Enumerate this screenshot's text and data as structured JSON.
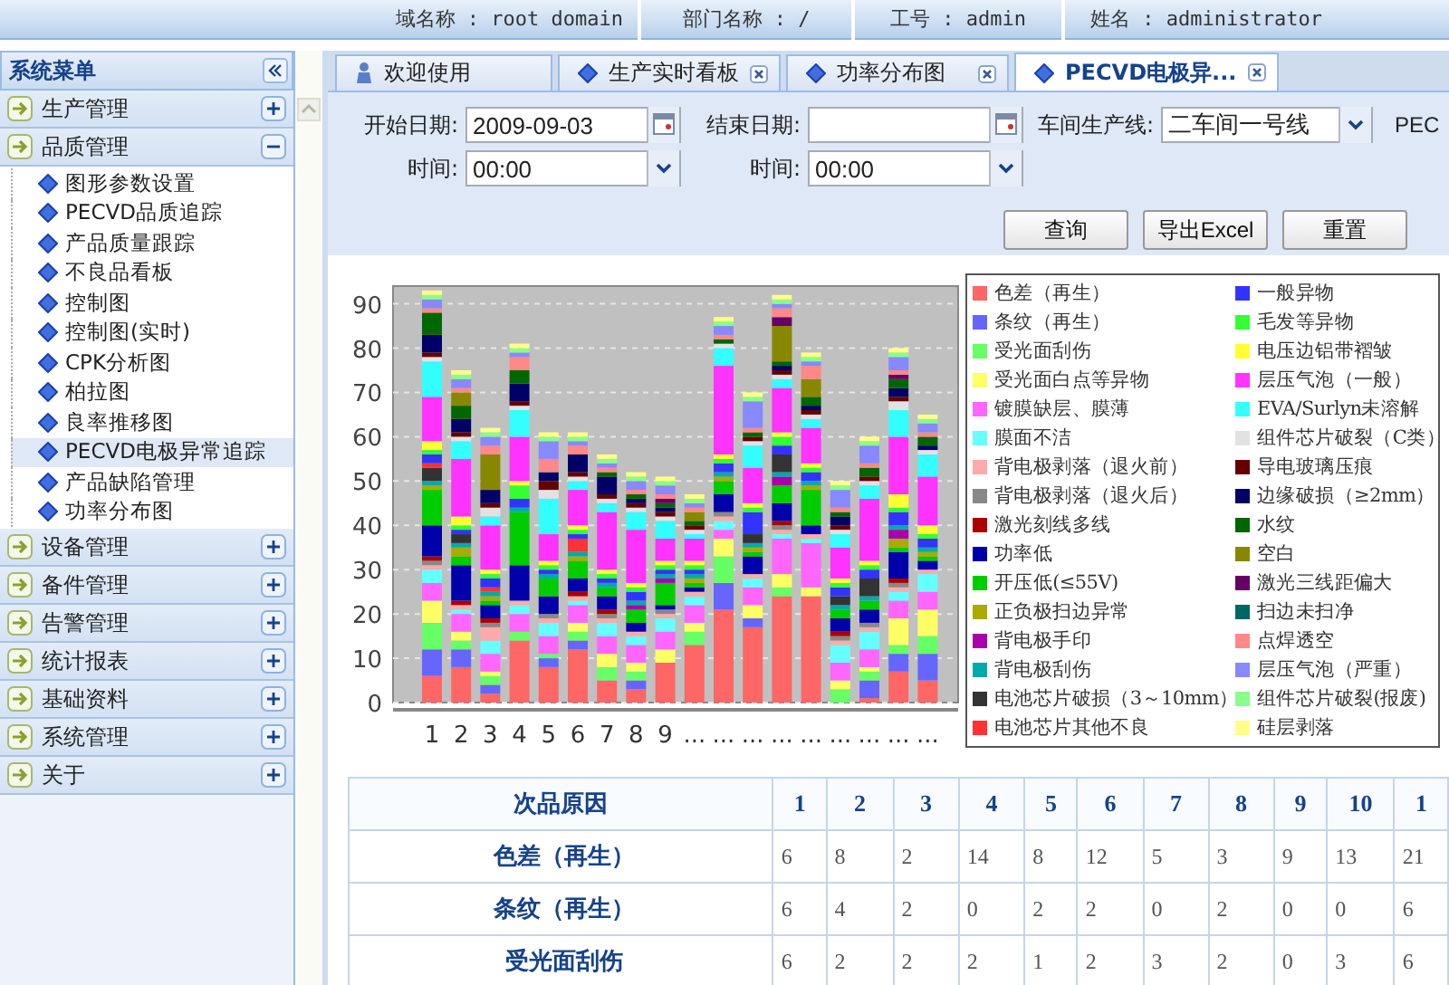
{
  "header": {
    "fields": [
      "域名称 : root domain",
      "部门名称 : /",
      "工号 : admin",
      "姓名 : administrator"
    ]
  },
  "sidebar": {
    "title": "系统菜单",
    "sections": [
      {
        "label": "生产管理",
        "expanded": false
      },
      {
        "label": "品质管理",
        "expanded": true,
        "children": [
          {
            "label": "图形参数设置",
            "selected": false
          },
          {
            "label": "PECVD品质追踪",
            "selected": false
          },
          {
            "label": "产品质量跟踪",
            "selected": false
          },
          {
            "label": "不良品看板",
            "selected": false
          },
          {
            "label": "控制图",
            "selected": false
          },
          {
            "label": "控制图(实时)",
            "selected": false
          },
          {
            "label": "CPK分析图",
            "selected": false
          },
          {
            "label": "柏拉图",
            "selected": false
          },
          {
            "label": "良率推移图",
            "selected": false
          },
          {
            "label": "PECVD电极异常追踪",
            "selected": true
          },
          {
            "label": "产品缺陷管理",
            "selected": false
          },
          {
            "label": "功率分布图",
            "selected": false
          }
        ]
      },
      {
        "label": "设备管理",
        "expanded": false
      },
      {
        "label": "备件管理",
        "expanded": false
      },
      {
        "label": "告警管理",
        "expanded": false
      },
      {
        "label": "统计报表",
        "expanded": false
      },
      {
        "label": "基础资料",
        "expanded": false
      },
      {
        "label": "系统管理",
        "expanded": false
      },
      {
        "label": "关于",
        "expanded": false
      }
    ]
  },
  "tabs": [
    {
      "label": "欢迎使用",
      "kind": "home",
      "selected": false
    },
    {
      "label": "生产实时看板",
      "kind": "page",
      "selected": false
    },
    {
      "label": "功率分布图",
      "kind": "page",
      "selected": false
    },
    {
      "label": "PECVD电极异...",
      "kind": "page",
      "selected": true
    }
  ],
  "form": {
    "start_date": {
      "label": "开始日期:",
      "value": "2009-09-03"
    },
    "end_date": {
      "label": "结束日期:"
    },
    "line": {
      "label": "车间生产线:",
      "value": "二车间一号线"
    },
    "cut_label": "PEC",
    "start_time": {
      "label": "时间:",
      "value": "00:00"
    },
    "end_time": {
      "label": "时间:",
      "value": "00:00"
    },
    "buttons": [
      "查询",
      "导出Excel",
      "重置"
    ]
  },
  "chart": {
    "chart_data": {
      "type": "bar",
      "stacked": true,
      "grid": true,
      "categories": [
        "1",
        "2",
        "3",
        "4",
        "5",
        "6",
        "7",
        "8",
        "9",
        "...",
        "...",
        "...",
        "...",
        "...",
        "...",
        "...",
        "...",
        "..."
      ],
      "ylim": [
        0,
        94
      ],
      "yticks": [
        0,
        10,
        20,
        30,
        40,
        50,
        60,
        70,
        80,
        90
      ],
      "series": [
        {
          "name": "色差（再生）",
          "color": "#ff6666",
          "values": [
            6,
            8,
            2,
            14,
            8,
            12,
            5,
            3,
            9,
            13,
            21,
            17,
            24,
            24,
            0,
            1,
            7,
            5
          ]
        },
        {
          "name": "条纹（再生）",
          "color": "#6666ff",
          "values": [
            6,
            4,
            2,
            0,
            2,
            2,
            0,
            2,
            0,
            0,
            6,
            2,
            0,
            0,
            0,
            4,
            4,
            6
          ]
        },
        {
          "name": "受光面刮伤",
          "color": "#66ff66",
          "values": [
            6,
            2,
            2,
            2,
            1,
            2,
            3,
            2,
            0,
            3,
            6,
            0,
            2,
            0,
            3,
            2,
            2,
            4
          ]
        },
        {
          "name": "受光面白点等异物",
          "color": "#ffff66",
          "values": [
            5,
            2,
            1,
            0,
            0,
            2,
            3,
            2,
            3,
            2,
            4,
            3,
            3,
            2,
            2,
            1,
            6,
            6
          ]
        },
        {
          "name": "镀膜缺层、膜薄",
          "color": "#ff66ff",
          "values": [
            4,
            4,
            4,
            4,
            4,
            4,
            4,
            4,
            4,
            4,
            2,
            4,
            8,
            10,
            4,
            4,
            4,
            4
          ]
        },
        {
          "name": "膜面不洁",
          "color": "#66ffff",
          "values": [
            3,
            1,
            3,
            2,
            3,
            1,
            3,
            2,
            3,
            2,
            2,
            2,
            1,
            1,
            4,
            4,
            2,
            4
          ]
        },
        {
          "name": "背电极剥落（退火前）",
          "color": "#ffaaaa",
          "values": [
            1,
            1,
            3,
            1,
            1,
            1,
            1,
            1,
            1,
            1,
            1,
            1,
            1,
            1,
            1,
            1,
            1,
            1
          ]
        },
        {
          "name": "背电极剥落（退火后）",
          "color": "#888888",
          "values": [
            1,
            0,
            1,
            0,
            1,
            0,
            1,
            0,
            1,
            0,
            1,
            0,
            1,
            0,
            1,
            1,
            1,
            0
          ]
        },
        {
          "name": "激光刻线多线",
          "color": "#aa0000",
          "values": [
            1,
            1,
            1,
            0,
            0,
            1,
            1,
            0,
            0,
            0,
            0,
            0,
            1,
            0,
            1,
            0,
            1,
            0
          ]
        },
        {
          "name": "功率低",
          "color": "#0000aa",
          "values": [
            7,
            8,
            3,
            8,
            4,
            3,
            3,
            2,
            1,
            1,
            4,
            4,
            4,
            2,
            3,
            3,
            6,
            2
          ]
        },
        {
          "name": "开压低(≤55V)",
          "color": "#00cc00",
          "values": [
            8,
            2,
            1,
            12,
            4,
            4,
            2,
            3,
            5,
            1,
            3,
            1,
            4,
            8,
            2,
            2,
            1,
            1
          ]
        },
        {
          "name": "正负极扫边异常",
          "color": "#aaaa00",
          "values": [
            1,
            2,
            1,
            0,
            0,
            1,
            0,
            0,
            0,
            1,
            1,
            1,
            0,
            1,
            0,
            0,
            2,
            1
          ]
        },
        {
          "name": "背电极手印",
          "color": "#aa00aa",
          "values": [
            0,
            0,
            0,
            0,
            0,
            0,
            0,
            1,
            1,
            0,
            0,
            0,
            2,
            0,
            0,
            0,
            2,
            0
          ]
        },
        {
          "name": "背电极刮伤",
          "color": "#00aaaa",
          "values": [
            1,
            1,
            1,
            1,
            1,
            1,
            1,
            1,
            1,
            1,
            1,
            1,
            1,
            1,
            1,
            1,
            1,
            1
          ]
        },
        {
          "name": "电池芯片破损（3～10mm）",
          "color": "#333333",
          "values": [
            3,
            2,
            0,
            0,
            0,
            0,
            0,
            0,
            0,
            0,
            0,
            2,
            4,
            0,
            2,
            4,
            0,
            0
          ]
        },
        {
          "name": "电池芯片其他不良",
          "color": "#ff3333",
          "values": [
            1,
            0,
            1,
            0,
            0,
            3,
            0,
            0,
            0,
            0,
            0,
            0,
            0,
            0,
            0,
            0,
            0,
            0
          ]
        },
        {
          "name": "一般异物",
          "color": "#3333ff",
          "values": [
            2,
            1,
            2,
            2,
            1,
            1,
            1,
            2,
            1,
            1,
            2,
            5,
            2,
            2,
            2,
            2,
            3,
            2
          ]
        },
        {
          "name": "毛发等异物",
          "color": "#33ff33",
          "values": [
            1,
            1,
            1,
            3,
            1,
            1,
            1,
            1,
            1,
            1,
            1,
            1,
            2,
            1,
            1,
            1,
            1,
            1
          ]
        },
        {
          "name": "电压边铝带褶皱",
          "color": "#ffff33",
          "values": [
            2,
            2,
            1,
            1,
            1,
            1,
            1,
            1,
            1,
            1,
            1,
            1,
            1,
            1,
            1,
            1,
            3,
            2
          ]
        },
        {
          "name": "层压气泡（一般）",
          "color": "#ff33ff",
          "values": [
            10,
            13,
            10,
            10,
            6,
            8,
            13,
            12,
            5,
            5,
            20,
            8,
            10,
            8,
            7,
            14,
            13,
            11
          ]
        },
        {
          "name": "EVA/Surlyn未溶解",
          "color": "#33ffff",
          "values": [
            8,
            4,
            2,
            6,
            8,
            2,
            2,
            4,
            4,
            1,
            4,
            5,
            2,
            2,
            3,
            3,
            6,
            5
          ]
        },
        {
          "name": "组件芯片破裂（C类）",
          "color": "#e2e2e2",
          "values": [
            1,
            1,
            2,
            1,
            2,
            1,
            1,
            1,
            1,
            1,
            1,
            1,
            1,
            1,
            1,
            1,
            2,
            1
          ]
        },
        {
          "name": "导电玻璃压痕",
          "color": "#660000",
          "values": [
            1,
            1,
            1,
            1,
            2,
            1,
            1,
            1,
            1,
            1,
            0,
            1,
            1,
            1,
            1,
            1,
            1,
            0
          ]
        },
        {
          "name": "边缘破损（≥2mm）",
          "color": "#000066",
          "values": [
            4,
            3,
            3,
            4,
            2,
            4,
            4,
            1,
            1,
            0,
            0,
            0,
            1,
            1,
            2,
            0,
            2,
            1
          ]
        },
        {
          "name": "水纹",
          "color": "#006600",
          "values": [
            5,
            3,
            0,
            3,
            0,
            0,
            1,
            1,
            1,
            1,
            1,
            1,
            1,
            2,
            1,
            2,
            2,
            2
          ]
        },
        {
          "name": "空白",
          "color": "#888800",
          "values": [
            0,
            3,
            8,
            0,
            0,
            0,
            0,
            0,
            0,
            2,
            0,
            0,
            8,
            4,
            0,
            0,
            0,
            0
          ]
        },
        {
          "name": "激光三线距偏大",
          "color": "#660066",
          "values": [
            0,
            0,
            0,
            0,
            0,
            0,
            0,
            0,
            1,
            0,
            0,
            0,
            2,
            0,
            0,
            0,
            1,
            0
          ]
        },
        {
          "name": "扫边未扫净",
          "color": "#006666",
          "values": [
            0,
            0,
            0,
            0,
            0,
            0,
            0,
            0,
            0,
            0,
            0,
            0,
            0,
            0,
            0,
            0,
            0,
            0
          ]
        },
        {
          "name": "点焊透空",
          "color": "#ff8888",
          "values": [
            1,
            1,
            2,
            3,
            3,
            2,
            1,
            1,
            1,
            1,
            1,
            1,
            2,
            3,
            1,
            1,
            1,
            1
          ]
        },
        {
          "name": "层压气泡（严重）",
          "color": "#8888ff",
          "values": [
            2,
            2,
            2,
            1,
            4,
            1,
            1,
            2,
            2,
            1,
            2,
            6,
            1,
            1,
            4,
            4,
            3,
            2
          ]
        },
        {
          "name": "组件芯片破裂(报废)",
          "color": "#88ff88",
          "values": [
            1,
            1,
            1,
            1,
            1,
            1,
            1,
            1,
            1,
            1,
            1,
            1,
            1,
            1,
            1,
            1,
            1,
            1
          ]
        },
        {
          "name": "硅层剥落",
          "color": "#ffff88",
          "values": [
            1,
            1,
            1,
            1,
            1,
            1,
            1,
            1,
            1,
            1,
            1,
            1,
            1,
            1,
            1,
            1,
            1,
            1
          ]
        }
      ]
    }
  },
  "table": {
    "columns": [
      "次品原因",
      "1",
      "2",
      "3",
      "4",
      "5",
      "6",
      "7",
      "8",
      "9",
      "10",
      "1"
    ],
    "rows": [
      {
        "cells": [
          "色差（再生）",
          "6",
          "8",
          "2",
          "14",
          "8",
          "12",
          "5",
          "3",
          "9",
          "13",
          "21"
        ]
      },
      {
        "cells": [
          "条纹（再生）",
          "6",
          "4",
          "2",
          "0",
          "2",
          "2",
          "0",
          "2",
          "0",
          "0",
          "6"
        ]
      },
      {
        "cells": [
          "受光面刮伤",
          "6",
          "2",
          "2",
          "2",
          "1",
          "2",
          "3",
          "2",
          "0",
          "3",
          "6"
        ]
      }
    ]
  }
}
